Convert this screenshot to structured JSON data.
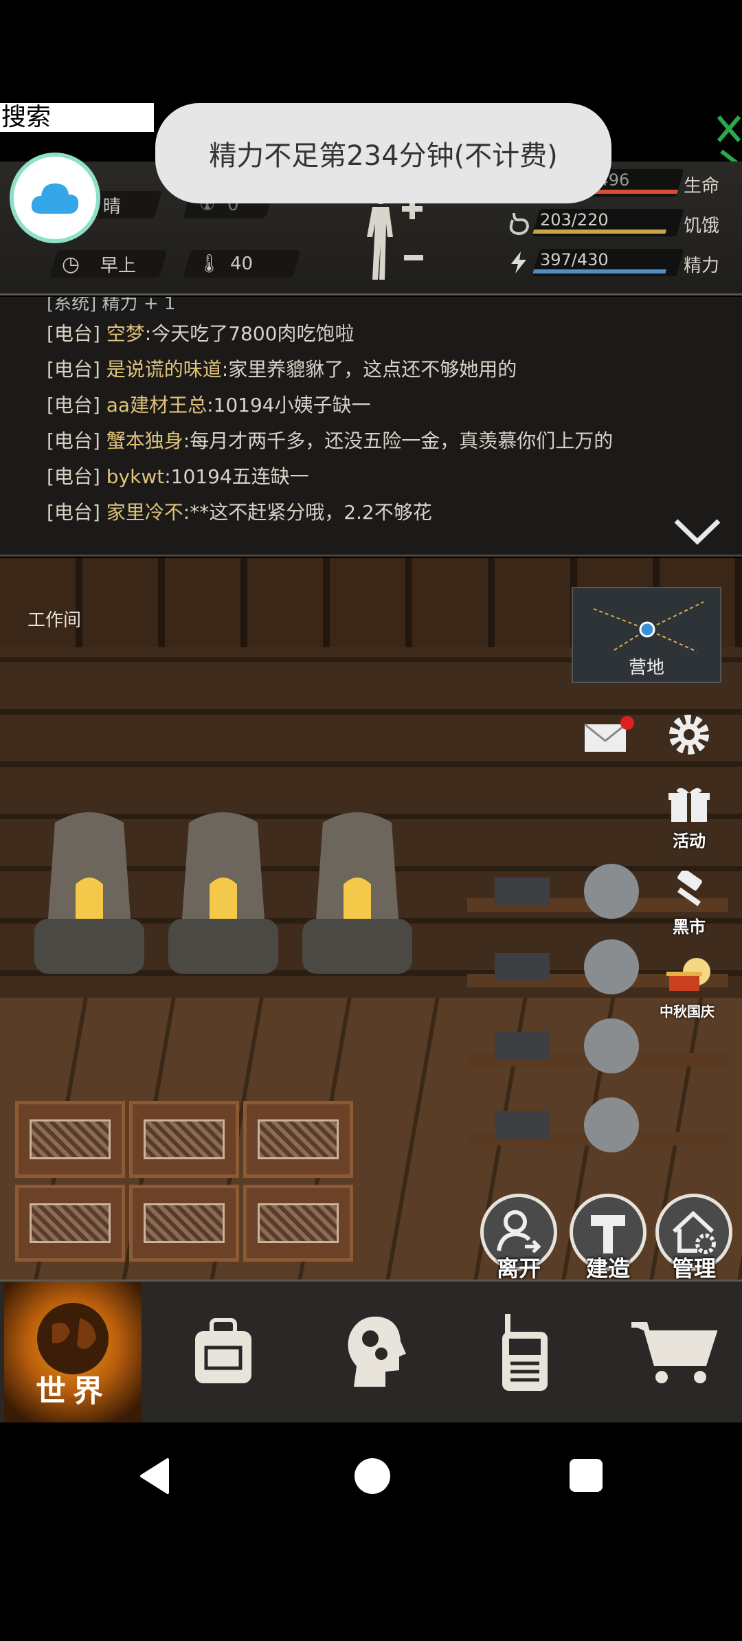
{
  "overlay": {
    "search_label": "搜索",
    "toast": "精力不足第234分钟(不计费)"
  },
  "status": {
    "weather": "晴",
    "time_of_day": "早上",
    "radiation": "0",
    "temperature": "40",
    "health": {
      "text": "5496/5496",
      "label": "生命",
      "fraction": 1.0,
      "color": "#d9502e"
    },
    "hunger": {
      "text": "203/220",
      "label": "饥饿",
      "fraction": 0.92,
      "color": "#caa64a"
    },
    "energy": {
      "text": "397/430",
      "label": "精力",
      "fraction": 0.92,
      "color": "#4f8fc7"
    }
  },
  "chat": {
    "cut_line": "[系统] 精力 + 1",
    "messages": [
      {
        "tag": "[电台]",
        "user": "空梦",
        "text": ":今天吃了7800肉吃饱啦"
      },
      {
        "tag": "[电台]",
        "user": "是说谎的味道",
        "text": ":家里养貔貅了，这点还不够她用的"
      },
      {
        "tag": "[电台]",
        "user": "aa建材王总",
        "text": ":10194小姨子缺一"
      },
      {
        "tag": "[电台]",
        "user": "蟹本独身",
        "text": ":每月才两千多，还没五险一金，真羡慕你们上万的"
      },
      {
        "tag": "[电台]",
        "user": "bykwt",
        "text": ":10194五连缺一"
      },
      {
        "tag": "[电台]",
        "user": "家里冷不",
        "text": ":**这不赶紧分哦，2.2不够花"
      }
    ]
  },
  "scene": {
    "room_name": "工作间",
    "minimap_label": "营地",
    "side_buttons": {
      "activity": "活动",
      "black_market": "黑市",
      "festival": "中秋国庆"
    },
    "actions": {
      "leave": "离开",
      "build": "建造",
      "manage": "管理"
    }
  },
  "nav": {
    "world": "世界"
  },
  "icons": [
    "cloud-icon",
    "radiation-icon",
    "clock-icon",
    "thermometer-icon",
    "heart-icon",
    "stomach-icon",
    "lightning-icon",
    "mail-icon",
    "gear-icon",
    "gift-icon",
    "hammer-icon",
    "lantern-icon",
    "backpack-icon",
    "head-gears-icon",
    "walkie-talkie-icon",
    "cart-icon",
    "back-icon",
    "home-icon",
    "recents-icon"
  ]
}
